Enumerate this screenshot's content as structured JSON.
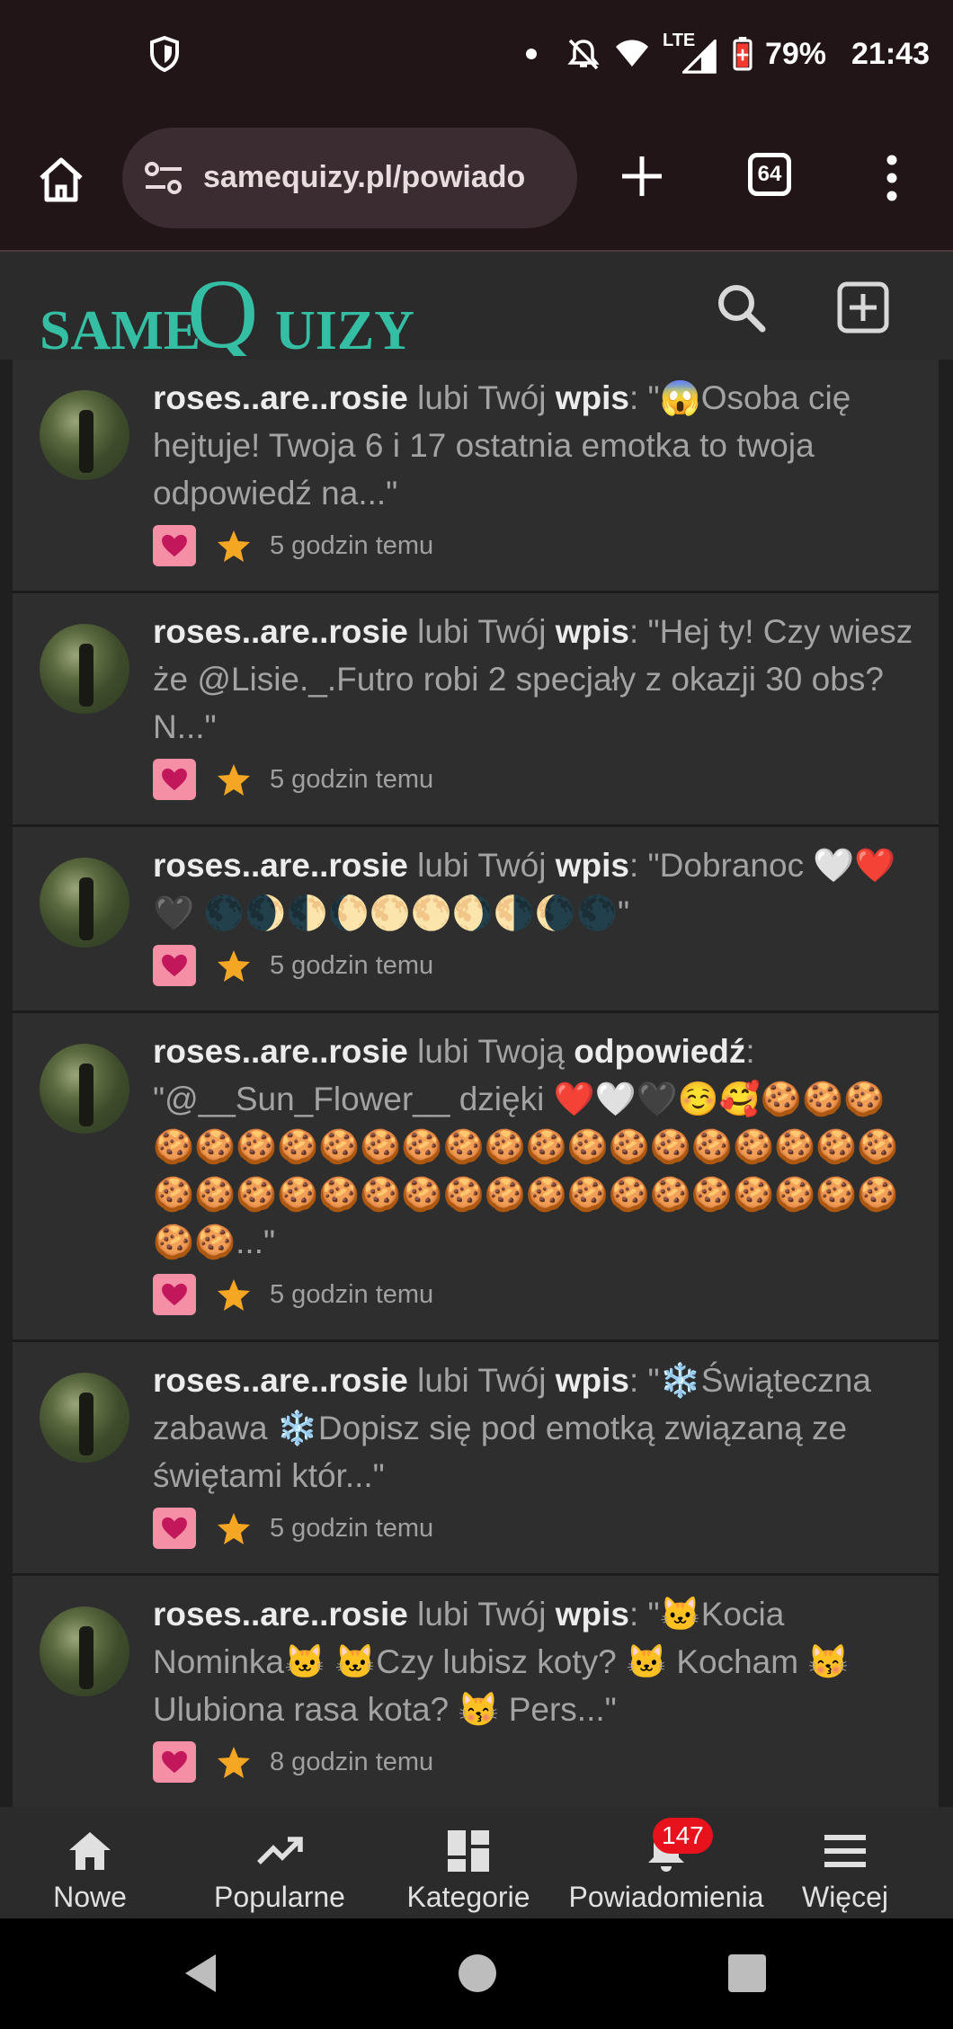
{
  "status_bar": {
    "battery": "79%",
    "time": "21:43",
    "network": "LTE",
    "icons": [
      "shield-icon",
      "dot-icon",
      "notifications-off-icon",
      "wifi-icon",
      "signal-icon",
      "battery-saver-icon"
    ]
  },
  "browser": {
    "url": "samequizy.pl/powiado",
    "tab_count": "64",
    "icons": [
      "home-icon",
      "tune-icon",
      "plus-icon",
      "more-vert-icon"
    ]
  },
  "site": {
    "logo_same": "SAME",
    "logo_q": "Q",
    "logo_rest": "UIZY",
    "colors": {
      "brand": "#34bfa4",
      "background": "#1f1f1f",
      "card": "#2e2e2e",
      "like_badge": "#f48fa5",
      "star": "#f5a623",
      "notification_badge": "#e8121d"
    }
  },
  "notifications": [
    {
      "user": "roses..are..rosie",
      "action": " lubi Twój ",
      "kind": "wpis",
      "quote": ": \"😱Osoba cię hejtuje! Twoja 6 i 17 ostatnia emotka to twoja odpowiedź na...\"",
      "time": "5 godzin temu"
    },
    {
      "user": "roses..are..rosie",
      "action": " lubi Twój ",
      "kind": "wpis",
      "quote": ": \"Hej ty! Czy wiesz że @Lisie._.Futro robi 2 specjały z okazji 30 obs? N...\"",
      "time": "5 godzin temu"
    },
    {
      "user": "roses..are..rosie",
      "action": " lubi Twój ",
      "kind": "wpis",
      "quote": ": \"Dobranoc 🤍❤️🖤 🌑🌒🌓🌔🌕🌕🌖🌗🌘🌑\"",
      "time": "5 godzin temu"
    },
    {
      "user": "roses..are..rosie",
      "action": " lubi Twoją ",
      "kind": "odpowiedź",
      "quote": ": \"@__Sun_Flower__ dzięki ❤️🤍🖤☺️🥰🍪🍪🍪🍪🍪🍪🍪🍪🍪🍪🍪🍪🍪🍪🍪🍪🍪🍪🍪🍪🍪🍪🍪🍪🍪🍪🍪🍪🍪🍪🍪🍪🍪🍪🍪🍪🍪🍪🍪🍪🍪...\"",
      "time": "5 godzin temu"
    },
    {
      "user": "roses..are..rosie",
      "action": " lubi Twój ",
      "kind": "wpis",
      "quote": ": \"❄️Świąteczna zabawa ❄️Dopisz się pod emotką związaną ze świętami któr...\"",
      "time": "5 godzin temu"
    },
    {
      "user": "roses..are..rosie",
      "action": " lubi Twój ",
      "kind": "wpis",
      "quote": ": \"🐱Kocia Nominka🐱 🐱Czy lubisz koty? 🐱 Kocham 😽 Ulubiona rasa kota? 😽 Pers...\"",
      "time": "8 godzin temu"
    }
  ],
  "bottom_nav": {
    "items": [
      {
        "label": "Nowe",
        "icon": "home-icon"
      },
      {
        "label": "Popularne",
        "icon": "trending-up-icon"
      },
      {
        "label": "Kategorie",
        "icon": "dashboard-icon"
      },
      {
        "label": "Powiadomienia",
        "icon": "bell-icon",
        "badge": "147"
      },
      {
        "label": "Więcej",
        "icon": "menu-icon"
      }
    ]
  },
  "android_nav": {
    "icons": [
      "back-icon",
      "home-circle-icon",
      "recents-icon"
    ]
  }
}
